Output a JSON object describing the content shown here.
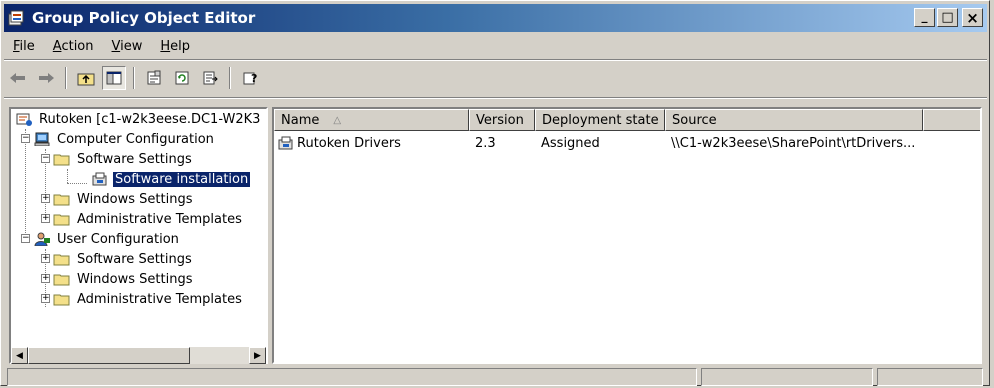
{
  "window": {
    "title": "Group Policy Object Editor",
    "icon": "gpo-editor-icon"
  },
  "caption_buttons": {
    "minimize": "_",
    "maximize": "□",
    "close": "×"
  },
  "menu": {
    "items": [
      {
        "label": "File",
        "accel": "F",
        "rest": "ile"
      },
      {
        "label": "Action",
        "accel": "A",
        "rest": "ction"
      },
      {
        "label": "View",
        "accel": "V",
        "rest": "iew"
      },
      {
        "label": "Help",
        "accel": "H",
        "rest": "elp"
      }
    ]
  },
  "toolbar": {
    "buttons": [
      "back-arrow-icon",
      "forward-arrow-icon",
      "up-folder-icon",
      "show-hide-tree-icon",
      "properties-icon",
      "refresh-icon",
      "export-list-icon",
      "help-icon"
    ]
  },
  "tree": {
    "items": [
      {
        "label": "Rutoken [c1-w2k3eese.DC1-W2K3",
        "icon": "gpo-icon"
      },
      {
        "label": "Computer Configuration",
        "icon": "computer-icon",
        "expander": "−"
      },
      {
        "label": "Software Settings",
        "icon": "folder-open-icon",
        "expander": "−"
      },
      {
        "label": "Software installation",
        "icon": "software-install-icon",
        "selected": true
      },
      {
        "label": "Windows Settings",
        "icon": "folder-icon",
        "expander": "+"
      },
      {
        "label": "Administrative Templates",
        "icon": "folder-icon",
        "expander": "+"
      },
      {
        "label": "User Configuration",
        "icon": "user-icon",
        "expander": "−"
      },
      {
        "label": "Software Settings",
        "icon": "folder-icon",
        "expander": "+"
      },
      {
        "label": "Windows Settings",
        "icon": "folder-icon",
        "expander": "+"
      },
      {
        "label": "Administrative Templates",
        "icon": "folder-icon",
        "expander": "+"
      }
    ]
  },
  "list": {
    "columns": [
      "Name",
      "Version",
      "Deployment state",
      "Source"
    ],
    "sort_indicator": "△",
    "rows": [
      {
        "name": "Rutoken Drivers",
        "version": "2.3",
        "deployment_state": "Assigned",
        "source": "\\\\C1-w2k3eese\\SharePoint\\rtDrivers..."
      }
    ]
  },
  "scrollbar": {
    "left_arrow": "◀",
    "right_arrow": "▶"
  },
  "colors": {
    "title_start": "#0a246a",
    "title_end": "#a6caf0",
    "selection": "#0a246a",
    "face": "#d4d0c8"
  }
}
